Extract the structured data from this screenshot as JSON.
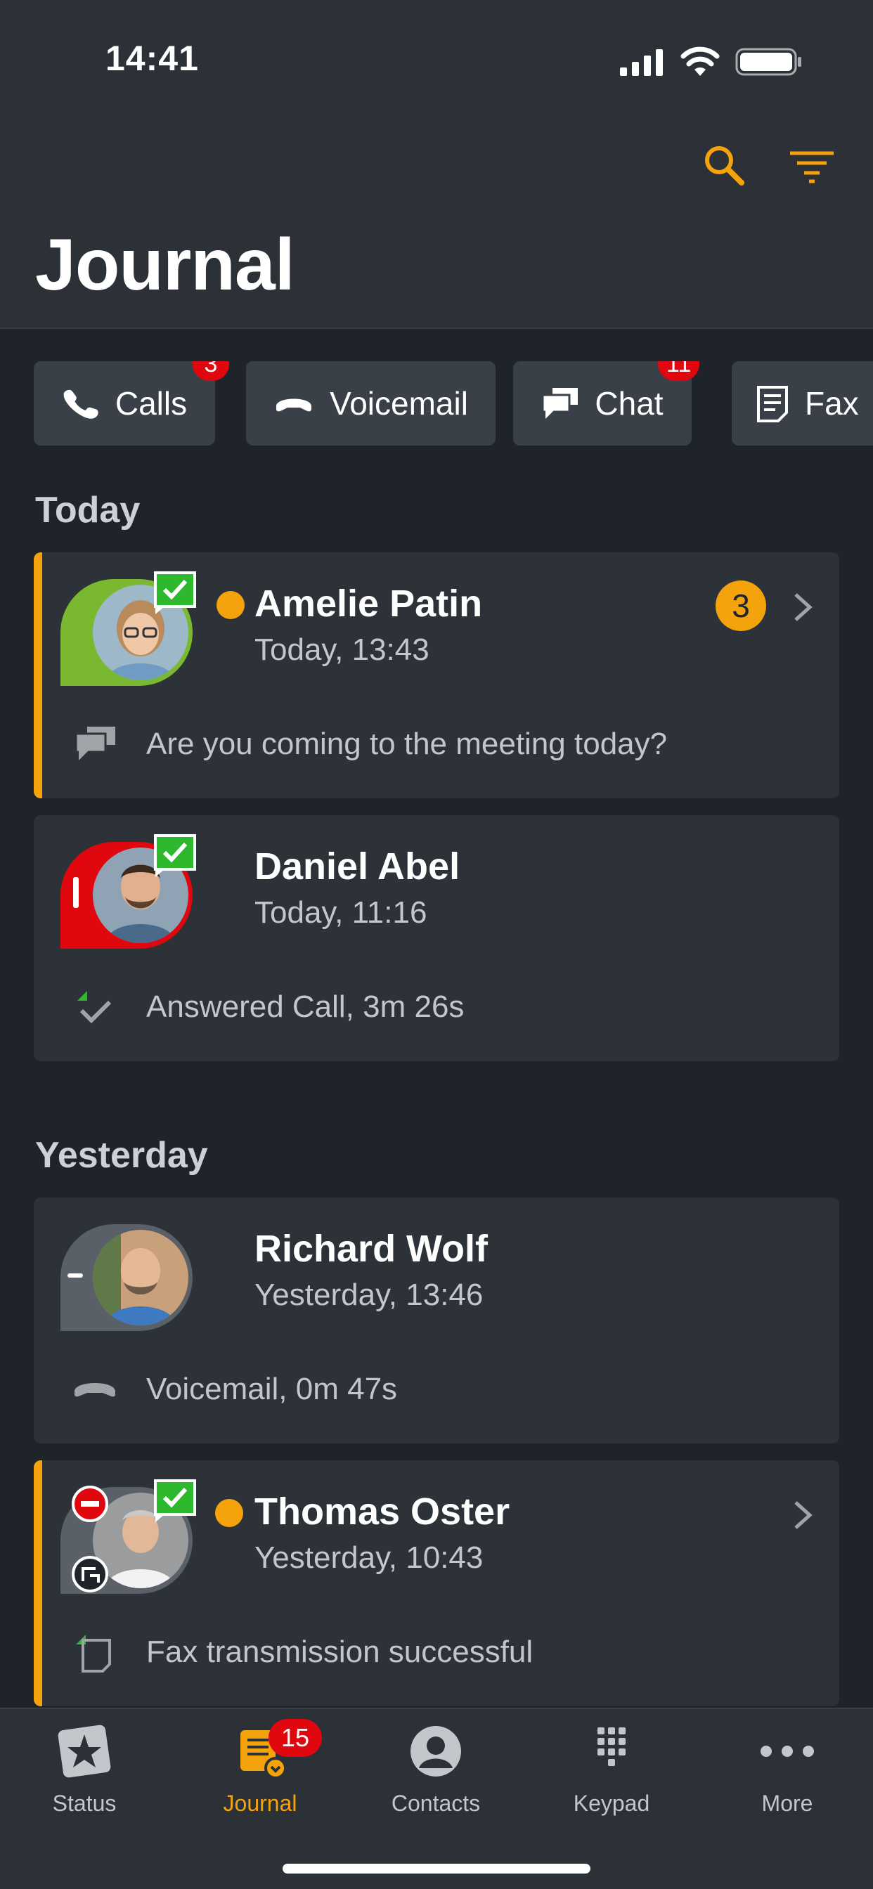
{
  "status_bar": {
    "time": "14:41"
  },
  "header": {
    "title": "Journal"
  },
  "tabs": [
    {
      "label": "Calls",
      "badge": "3"
    },
    {
      "label": "Voicemail"
    },
    {
      "label": "Chat",
      "badge": "11"
    },
    {
      "label": "Fax"
    }
  ],
  "sections": [
    {
      "label": "Today",
      "items": [
        {
          "name": "Amelie Patin",
          "time": "Today, 13:43",
          "detail": "Are you coming to the meeting today?",
          "unread": "3",
          "avatar_color": "#7ab92f"
        },
        {
          "name": "Daniel Abel",
          "time": "Today, 11:16",
          "detail": "Answered Call, 3m 26s",
          "avatar_color": "#e0070f"
        }
      ]
    },
    {
      "label": "Yesterday",
      "items": [
        {
          "name": "Richard Wolf",
          "time": "Yesterday, 13:46",
          "detail": "Voicemail, 0m 47s",
          "avatar_color": "#5a6068"
        },
        {
          "name": "Thomas Oster",
          "time": "Yesterday, 10:43",
          "detail": "Fax transmission successful",
          "avatar_color": "#5a6068"
        }
      ]
    }
  ],
  "tabbar": [
    {
      "label": "Status",
      "icon": "star-icon"
    },
    {
      "label": "Journal",
      "icon": "journal-icon",
      "badge": "15"
    },
    {
      "label": "Contacts",
      "icon": "contact-icon"
    },
    {
      "label": "Keypad",
      "icon": "keypad-icon"
    },
    {
      "label": "More",
      "icon": "more-icon"
    }
  ],
  "colors": {
    "accent": "#f4a30c",
    "badge": "#e0070f",
    "presence_ok": "#2db82d"
  }
}
